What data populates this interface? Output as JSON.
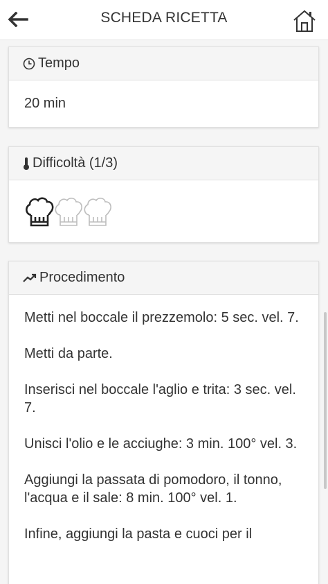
{
  "header": {
    "title": "SCHEDA RICETTA",
    "back_icon": "arrow-left-icon",
    "home_icon": "home-icon"
  },
  "tempo": {
    "label": "Tempo",
    "icon": "clock-icon",
    "value": "20 min"
  },
  "difficolta": {
    "label": "Difficoltà (1/3)",
    "icon": "thermometer-icon",
    "level": 1,
    "max": 3,
    "active_color": "#222222",
    "inactive_color": "#bdbdbd"
  },
  "procedimento": {
    "label": "Procedimento",
    "icon": "trend-icon",
    "steps": [
      "Metti nel boccale il prezzemolo: 5 sec. vel. 7.",
      "Metti da parte.",
      "Inserisci nel boccale l'aglio e trita: 3 sec. vel. 7.",
      "Unisci l'olio e le acciughe: 3 min. 100° vel. 3.",
      "Aggiungi la passata di pomodoro, il tonno, l'acqua e il sale: 8 min. 100° vel. 1.",
      "Infine, aggiungi la pasta e cuoci per il"
    ]
  }
}
